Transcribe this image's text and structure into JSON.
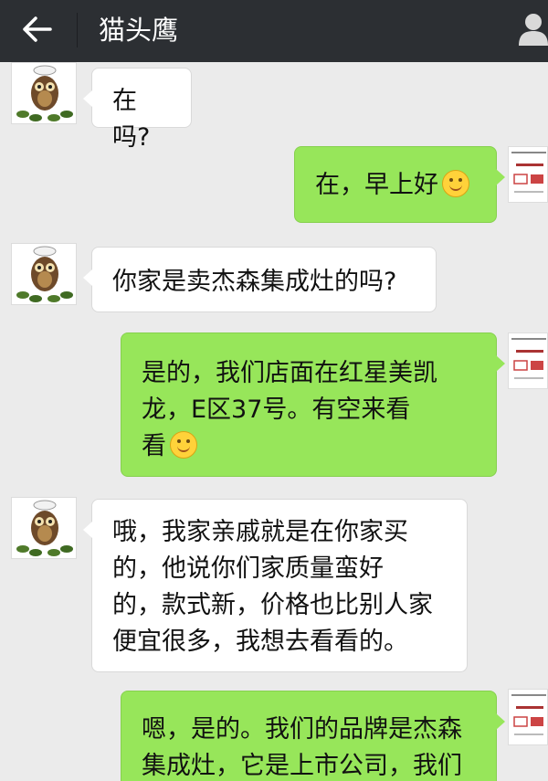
{
  "header": {
    "title": "猫头鹰",
    "back_icon": "back-arrow-icon",
    "profile_icon": "person-icon"
  },
  "messages": [
    {
      "side": "in",
      "text": "在吗?",
      "emoji": false
    },
    {
      "side": "out",
      "text": "在，早上好",
      "emoji": true
    },
    {
      "side": "in",
      "text": "你家是卖杰森集成灶的吗?",
      "emoji": false
    },
    {
      "side": "out",
      "lines": [
        "是的，我们店面在红星美凯",
        "龙，E区37号。有空来看",
        "看"
      ],
      "emoji": true
    },
    {
      "side": "in",
      "lines": [
        "哦，我家亲戚就是在你家买",
        "的，他说你们家质量蛮好",
        "的，款式新，价格也比别人家",
        "便宜很多，我想去看看的。"
      ],
      "emoji": false
    },
    {
      "side": "out",
      "lines": [
        "嗯，是的。我们的品牌是杰森",
        "集成灶，它是上市公司，我们"
      ],
      "emoji": false
    }
  ],
  "colors": {
    "header_bg": "#2c2f33",
    "chat_bg": "#ebebeb",
    "outgoing_bubble": "#97e65a",
    "incoming_bubble": "#ffffff"
  }
}
